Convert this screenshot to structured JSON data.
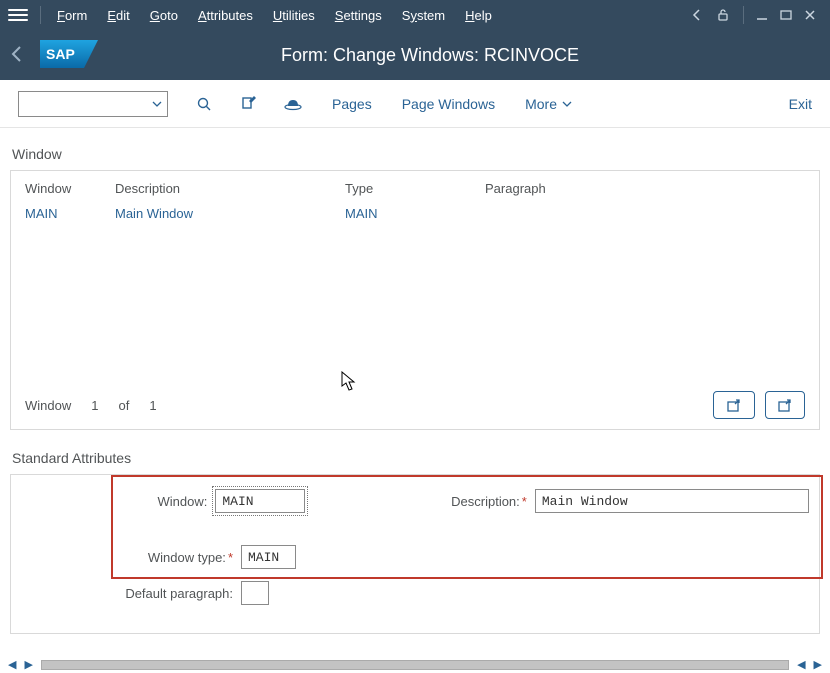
{
  "menubar": {
    "items": [
      "Form",
      "Edit",
      "Goto",
      "Attributes",
      "Utilities",
      "Settings",
      "System",
      "Help"
    ]
  },
  "header": {
    "title": "Form: Change Windows: RCINVOCE"
  },
  "toolbar": {
    "pages": "Pages",
    "page_windows": "Page Windows",
    "more": "More",
    "exit": "Exit"
  },
  "window_section": {
    "title": "Window",
    "headers": {
      "window": "Window",
      "description": "Description",
      "type": "Type",
      "paragraph": "Paragraph"
    },
    "rows": [
      {
        "window": "MAIN",
        "description": "Main Window",
        "type": "MAIN",
        "paragraph": ""
      }
    ],
    "footer": {
      "label": "Window",
      "current": "1",
      "of": "of",
      "total": "1"
    }
  },
  "attrs": {
    "title": "Standard Attributes",
    "labels": {
      "window": "Window:",
      "description": "Description:",
      "window_type": "Window type:",
      "default_paragraph": "Default paragraph:"
    },
    "values": {
      "window": "MAIN",
      "description": "Main Window",
      "window_type": "MAIN",
      "default_paragraph": ""
    }
  }
}
